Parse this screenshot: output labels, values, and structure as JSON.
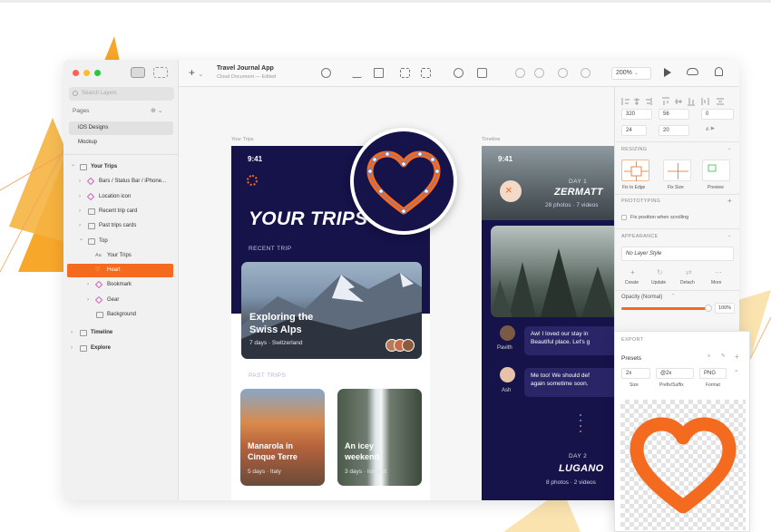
{
  "colors": {
    "accent": "#f46a1e",
    "navy": "#16124a",
    "symbol": "#d15ab9",
    "traffic": [
      "#fe5f57",
      "#febc2e",
      "#28c840"
    ]
  },
  "window": {
    "title": "Travel Journal App",
    "subtitle": "Cloud Document — Edited"
  },
  "toolbar": {
    "zoom": "200%",
    "icons": [
      "insert-icon",
      "symbol-icon",
      "style-icon",
      "text-icon",
      "group-icon",
      "ungroup-icon",
      "edit-icon",
      "transform-icon",
      "rotate-icon",
      "flip-icon",
      "mask-icon",
      "scale-icon",
      "union-icon",
      "subtract-icon",
      "intersect-icon",
      "difference-icon",
      "preview-icon",
      "cloud-icon",
      "notifications-icon"
    ]
  },
  "sidebar": {
    "search_placeholder": "Search Layers",
    "pages_header": "Pages",
    "pages": [
      {
        "label": "iOS Designs",
        "active": true
      },
      {
        "label": "Mockup",
        "active": false
      }
    ],
    "layers": [
      {
        "label": "Your Trips",
        "indent": 0,
        "type": "artboard",
        "expanded": true
      },
      {
        "label": "Bars / Status Bar / iPhone...",
        "indent": 1,
        "type": "symbol"
      },
      {
        "label": "Location icon",
        "indent": 1,
        "type": "symbol"
      },
      {
        "label": "Recent trip card",
        "indent": 1,
        "type": "group"
      },
      {
        "label": "Past trips cards",
        "indent": 1,
        "type": "group"
      },
      {
        "label": "Top",
        "indent": 1,
        "type": "group",
        "expanded": true
      },
      {
        "label": "Your Trips",
        "indent": 2,
        "type": "text"
      },
      {
        "label": "Heart",
        "indent": 2,
        "type": "shape",
        "selected": true
      },
      {
        "label": "Bookmark",
        "indent": 2,
        "type": "symbol"
      },
      {
        "label": "Gear",
        "indent": 2,
        "type": "symbol"
      },
      {
        "label": "Background",
        "indent": 2,
        "type": "shape"
      },
      {
        "label": "Timeline",
        "indent": 0,
        "type": "artboard"
      },
      {
        "label": "Explore",
        "indent": 0,
        "type": "artboard"
      }
    ]
  },
  "canvas": {
    "artboard1_label": "Your Trips",
    "artboard2_label": "Timeline",
    "your_trips": {
      "time": "9:41",
      "title": "YOUR TRIPS",
      "recent_trip_label": "RECENT TRIP",
      "recent_card_title": "Exploring the\nSwiss Alps",
      "recent_card_title_l1": "Exploring the",
      "recent_card_title_l2": "Swiss Alps",
      "recent_card_sub": "7 days · Switzerland",
      "past_trips_label": "PAST TRIPS",
      "past": [
        {
          "title_l1": "Manarola in",
          "title_l2": "Cinque Terre",
          "sub": "5 days · Italy"
        },
        {
          "title_l1": "An icey",
          "title_l2": "weekend",
          "sub": "3 days · Iceland"
        }
      ]
    },
    "timeline": {
      "time": "9:41",
      "day1_label": "DAY 1",
      "day1_city": "ZERMATT",
      "day1_sub": "28 photos · 7 videos",
      "chat": [
        {
          "name": "Pavith",
          "line1": "Aw! I loved our stay in",
          "line2": "Beautiful place. Let's g"
        },
        {
          "name": "Ash",
          "line1": "Me too! We should def",
          "line2": "again sometime soon."
        }
      ],
      "day2_label": "DAY 2",
      "day2_city": "LUGANO",
      "day2_sub": "8 photos · 2 videos"
    }
  },
  "inspector": {
    "x": "320",
    "y": "56",
    "w": "24",
    "h": "20",
    "rotation": "0",
    "resizing_header": "RESIZING",
    "resizing_options": [
      "Fix to Edge",
      "Fix Size",
      "Preview"
    ],
    "prototyping_header": "PROTOTYPING",
    "fix_position_label": "Fix position when scrolling",
    "appearance_header": "APPEARANCE",
    "layer_style": "No Layer Style",
    "style_actions": [
      "Create",
      "Update",
      "Detach",
      "More"
    ],
    "opacity_label": "Opacity (Normal)",
    "opacity_value": "100%",
    "opacity_fraction": 1.0,
    "export_header": "EXPORT",
    "presets_label": "Presets",
    "export_size": "2x",
    "export_suffix": "@2x",
    "export_format": "PNG",
    "export_col_labels": [
      "Size",
      "Prefix/Suffix",
      "Format"
    ]
  }
}
